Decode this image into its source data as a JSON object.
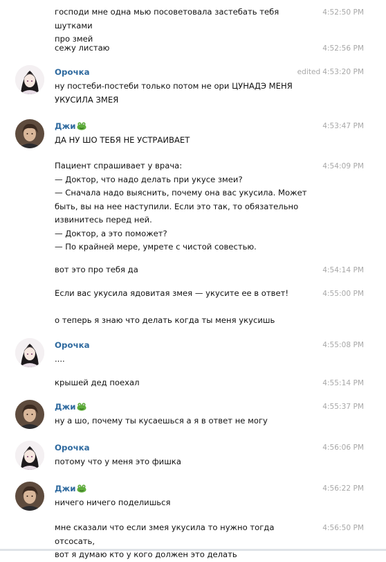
{
  "messages": [
    {
      "text": "господи мне одна мью посоветовала застебать тебя шутками\nпро змей",
      "time": "4:52:50 PM"
    },
    {
      "text": "сежу листаю",
      "time": "4:52:56 PM"
    },
    {
      "author": "Орочка",
      "text": "ну постеби-постеби только потом не ори ЦУНАДЭ МЕНЯ\nУКУСИЛА ЗМЕЯ",
      "time": "4:53:20 PM",
      "edited": "edited"
    },
    {
      "author": "Джи",
      "text": "ДА НУ ШО ТЕБЯ НЕ УСТРАИВАЕТ",
      "time": "4:53:47 PM"
    },
    {
      "text": "Пациент спрашивает у врача:\n— Доктор, что надо делать при укусе змеи?\n— Сначала надо выяснить, почему она вас укусила. Может\nбыть, вы на нее наступили. Если это так, то обязательно\nизвинитесь перед ней.\n— Доктор, а это поможет?\n— По крайней мере, умрете с чистой совестью.",
      "time": "4:54:09 PM"
    },
    {
      "text": "вот это про тебя да",
      "time": "4:54:14 PM"
    },
    {
      "text": "Если вас укусила ядовитая змея — укусите ее в ответ!",
      "time": "4:55:00 PM"
    },
    {
      "text": "о теперь я знаю что делать когда ты меня укусишь"
    },
    {
      "author": "Орочка",
      "text": "....",
      "time": "4:55:08 PM"
    },
    {
      "text": "крышей дед поехал",
      "time": "4:55:14 PM"
    },
    {
      "author": "Джи",
      "text": "ну а шо, почему ты кусаешься а я в ответ не могу",
      "time": "4:55:37 PM"
    },
    {
      "author": "Орочка",
      "text": "потому что у меня это фишка",
      "time": "4:56:06 PM"
    },
    {
      "author": "Джи",
      "text": "ничего ничего поделишься",
      "time": "4:56:22 PM"
    },
    {
      "text": "мне сказали что если змея укусила то нужно тогда отсосать,\nвот я думаю кто у кого должен это делать",
      "time": "4:56:50 PM"
    }
  ],
  "icons": {
    "author_badge_jee": "frog-emoji-icon"
  },
  "colors": {
    "author_name": "#2f6a9f",
    "timestamp": "#a8a8a8",
    "text": "#111111"
  }
}
